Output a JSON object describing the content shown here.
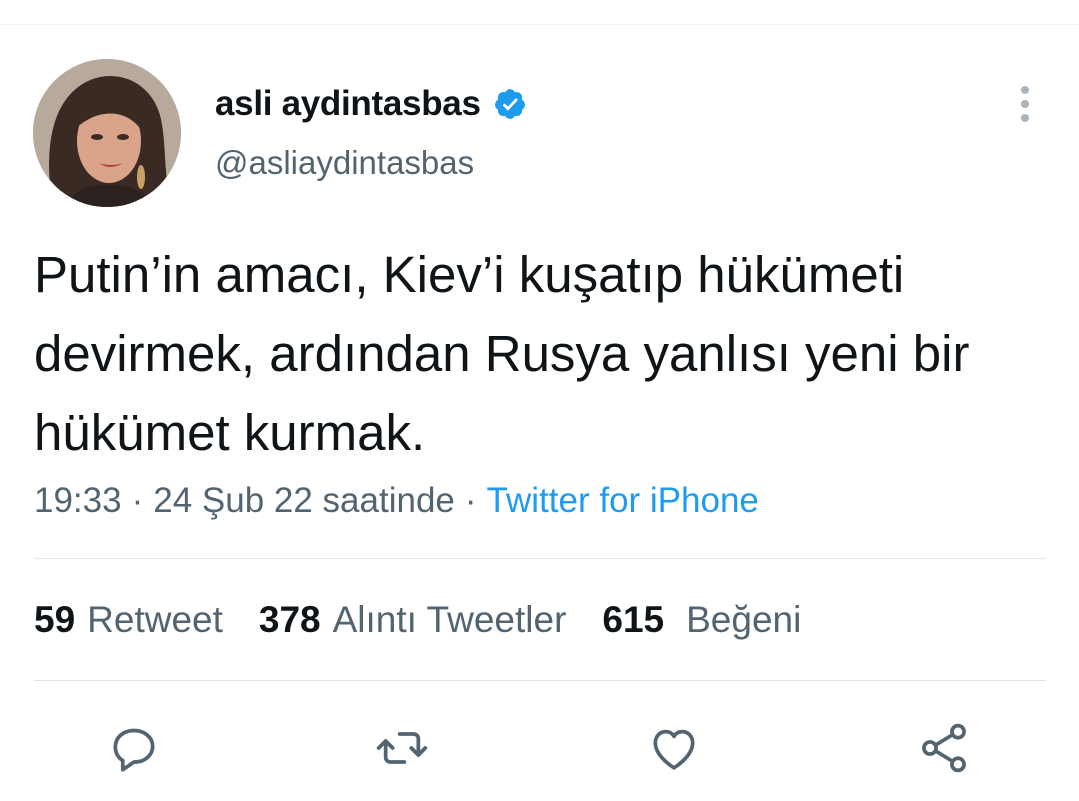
{
  "author": {
    "display_name": "asli aydintasbas",
    "handle": "@asliaydintasbas",
    "verified": true
  },
  "tweet": {
    "text": "Putin’in amacı, Kiev’i kuşatıp hükümeti devirmek, ardından Rusya yanlısı yeni bir hükümet kurmak.",
    "time": "19:33",
    "date": "24 Şub 22 saatinde",
    "separator": "·",
    "source": "Twitter for iPhone"
  },
  "stats": {
    "retweets": {
      "count": "59",
      "label": "Retweet"
    },
    "quotes": {
      "count": "378",
      "label": "Alıntı Tweetler"
    },
    "likes": {
      "count": "615",
      "label": "Beğeni"
    }
  },
  "actions": [
    {
      "name": "reply",
      "icon": "reply-bubble-icon"
    },
    {
      "name": "retweet",
      "icon": "retweet-icon"
    },
    {
      "name": "like",
      "icon": "heart-icon"
    },
    {
      "name": "share",
      "icon": "share-icon"
    }
  ],
  "colors": {
    "accent": "#1d9bf0",
    "text_primary": "#0f1419",
    "text_secondary": "#536471",
    "divider": "#e1e6e9"
  }
}
